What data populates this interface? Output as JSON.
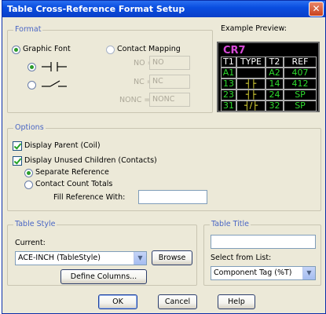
{
  "window": {
    "title": "Table Cross-Reference Format Setup",
    "close": "✕"
  },
  "format": {
    "legend": "Format",
    "graphic_font": "Graphic Font",
    "contact_mapping": "Contact Mapping",
    "no_label": "NO =",
    "no_value": "NO",
    "nc_label": "NC =",
    "nc_value": "NC",
    "nonc_label": "NONC =",
    "nonc_value": "NONC"
  },
  "preview": {
    "label": "Example Preview:",
    "title": "CR7",
    "headers": [
      "T1",
      "TYPE",
      "T2",
      "REF"
    ],
    "rows": [
      [
        "A1",
        "",
        "A2",
        "407"
      ],
      [
        "13",
        "┤├",
        "14",
        "412"
      ],
      [
        "23",
        "┤├",
        "24",
        "SP"
      ],
      [
        "31",
        "┤/├",
        "32",
        "SP"
      ]
    ]
  },
  "options": {
    "legend": "Options",
    "display_parent": "Display Parent (Coil)",
    "display_unused": "Display Unused Children (Contacts)",
    "separate_reference": "Separate Reference",
    "contact_count_totals": "Contact Count Totals",
    "fill_reference_label": "Fill Reference With:",
    "fill_reference_value": ""
  },
  "table_style": {
    "legend": "Table Style",
    "current_label": "Current:",
    "current_value": "ACE-INCH  (TableStyle)",
    "browse": "Browse",
    "define_columns": "Define Columns..."
  },
  "table_title": {
    "legend": "Table Title",
    "title_value": "",
    "select_label": "Select from List:",
    "select_value": "Component Tag (%T)"
  },
  "footer": {
    "ok": "OK",
    "cancel": "Cancel",
    "help": "Help"
  }
}
